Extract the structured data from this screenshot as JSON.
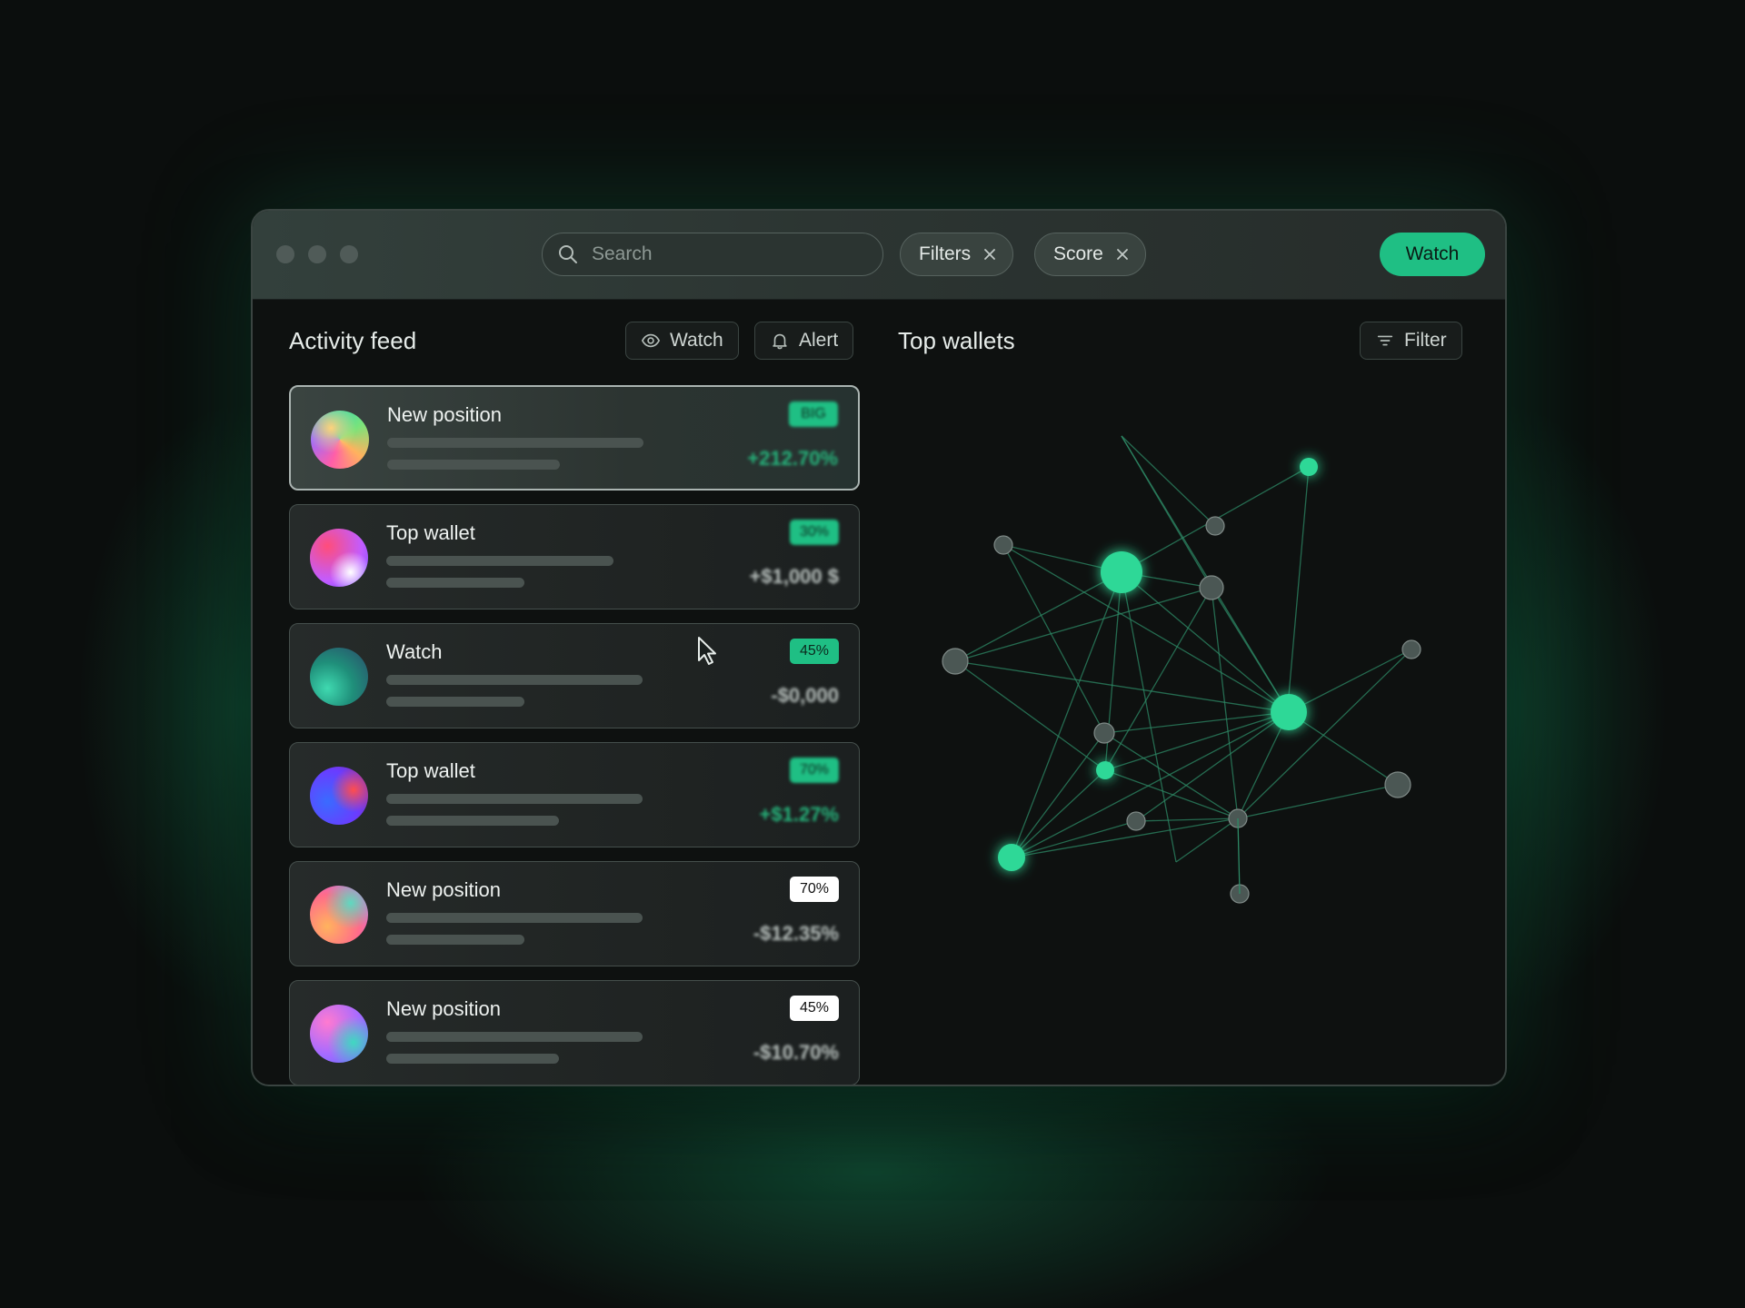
{
  "window": {
    "search": {
      "placeholder": "Search",
      "value": ""
    },
    "chips": [
      {
        "label": "Filters"
      },
      {
        "label": "Score"
      }
    ],
    "primary_button": "Watch"
  },
  "activity_feed": {
    "title": "Activity feed",
    "watch_label": "Watch",
    "alert_label": "Alert",
    "items": [
      {
        "title": "New position",
        "badge": "BIG",
        "amount": "+212.70%",
        "badge_style": "green",
        "amount_style": "pos",
        "avatar": "conic-pink-teal"
      },
      {
        "title": "Top wallet",
        "badge": "30%",
        "amount": "+$1,000 $",
        "badge_style": "green",
        "amount_style": "neu",
        "avatar": "radial-pink-violet"
      },
      {
        "title": "Watch",
        "badge": "45%",
        "amount": "-$0,000",
        "badge_style": "green",
        "amount_style": "neu",
        "avatar": "teal-green"
      },
      {
        "title": "Top wallet",
        "badge": "70%",
        "amount": "+$1.27%",
        "badge_style": "green",
        "amount_style": "pos",
        "avatar": "blue-red"
      },
      {
        "title": "New position",
        "badge": "70%",
        "amount": "-$12.35%",
        "badge_style": "white",
        "amount_style": "neu",
        "avatar": "orange-teal"
      },
      {
        "title": "New position",
        "badge": "45%",
        "amount": "-$10.70%",
        "badge_style": "white",
        "amount_style": "neu",
        "avatar": "violet-teal"
      }
    ]
  },
  "top_wallets": {
    "title": "Top wallets",
    "filter_label": "Filter"
  },
  "colors": {
    "accent": "#1fbf84",
    "node": "#2fd897",
    "node_dim": "#4b5754",
    "edge": "#2e8a66"
  }
}
